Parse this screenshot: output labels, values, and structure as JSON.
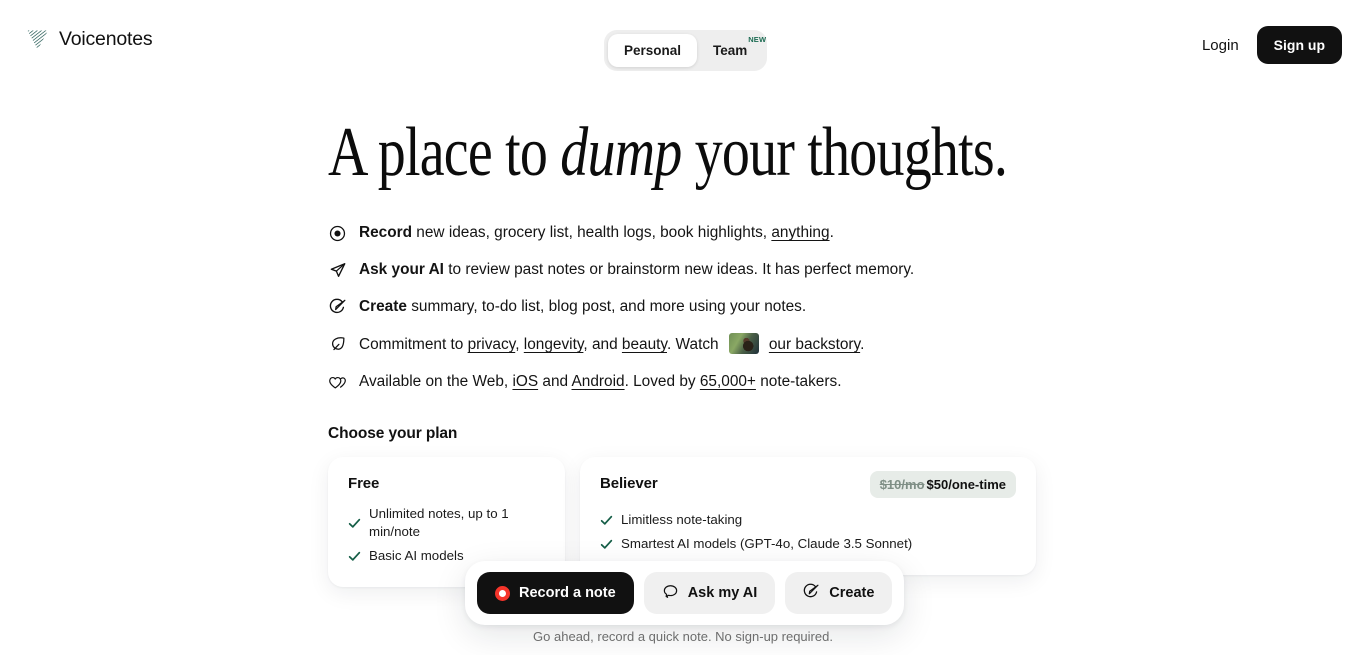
{
  "brand": {
    "name": "Voicenotes",
    "logo_icon": "voicenotes-logo-icon"
  },
  "tabs": {
    "personal": "Personal",
    "team": "Team",
    "team_badge": "NEW"
  },
  "auth": {
    "login": "Login",
    "signup": "Sign up"
  },
  "hero": {
    "headline_before": "A place to ",
    "headline_emphasis": "dump",
    "headline_after": " your thoughts."
  },
  "features": [
    {
      "icon": "record-circle-icon",
      "lead": "Record",
      "text_1": " new ideas, grocery list, health logs, book highlights, ",
      "link_1": "anything",
      "text_2": "."
    },
    {
      "icon": "paper-plane-icon",
      "lead": "Ask your AI",
      "text_1": " to review past notes or brainstorm new ideas. It has perfect memory."
    },
    {
      "icon": "magic-wand-icon",
      "lead": "Create",
      "text_1": " summary, to-do list, blog post, and more using your notes."
    },
    {
      "icon": "leaf-icon",
      "text_1": "Commitment to ",
      "link_1": "privacy",
      "text_2": ", ",
      "link_2": "longevity",
      "text_3": ", and ",
      "link_3": "beauty",
      "text_4": ". Watch ",
      "thumbnail": "backstory-video-thumbnail",
      "link_4": "our backstory",
      "text_5": "."
    },
    {
      "icon": "hearts-icon",
      "text_1": "Available on the Web, ",
      "link_1": "iOS",
      "text_2": " and ",
      "link_2": "Android",
      "text_3": ". Loved by ",
      "link_3": "65,000+",
      "text_4": " note-takers."
    }
  ],
  "plans": {
    "title": "Choose your plan",
    "cards": [
      {
        "name": "Free",
        "items": [
          "Unlimited notes, up to 1 min/note",
          "Basic AI models"
        ]
      },
      {
        "name": "Believer",
        "price_old": "$10/mo",
        "price_new": "$50/one-time",
        "items": [
          "Limitless note-taking",
          "Smartest AI models (GPT-4o, Claude 3.5 Sonnet)"
        ]
      }
    ]
  },
  "dock": {
    "record_label": "Record a note",
    "ask_label": "Ask my AI",
    "create_label": "Create",
    "caption": "Go ahead, record a quick note. No sign-up required."
  },
  "colors": {
    "accent_dark": "#111111",
    "record_red": "#f5342a",
    "check_green": "#155e47",
    "badge_green": "#1b6b52",
    "price_badge_bg": "#e7ece8"
  }
}
